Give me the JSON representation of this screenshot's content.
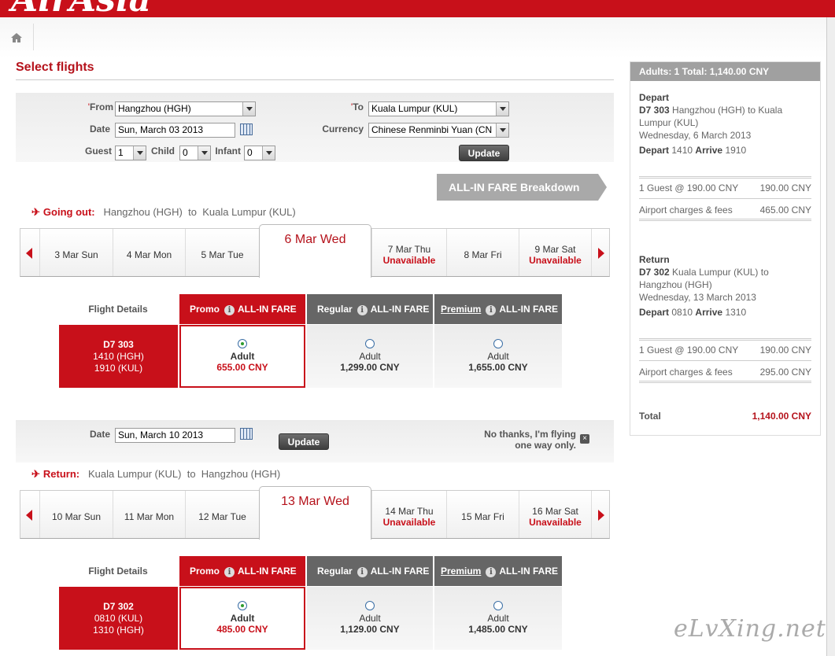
{
  "brand": {
    "logo": "AirAsia",
    "red": "#c8101a"
  },
  "nav": {
    "home_icon": "home-icon"
  },
  "page": {
    "title": "Select flights"
  },
  "search": {
    "from_label": "From",
    "from_value": "Hangzhou (HGH)",
    "to_label": "To",
    "to_value": "Kuala Lumpur (KUL)",
    "date_label": "Date",
    "date_value": "Sun, March 03 2013",
    "currency_label": "Currency",
    "currency_value": "Chinese Renminbi Yuan (CN",
    "guest_label": "Guest",
    "guest_value": "1",
    "child_label": "Child",
    "child_value": "0",
    "infant_label": "Infant",
    "infant_value": "0",
    "update_label": "Update"
  },
  "breakdown": {
    "label": "ALL-IN FARE Breakdown"
  },
  "outbound": {
    "label": "Going out:",
    "from": "Hangzhou (HGH)",
    "to_word": "to",
    "to": "Kuala Lumpur (KUL)",
    "dates": [
      {
        "label": "3 Mar Sun",
        "status": ""
      },
      {
        "label": "4 Mar Mon",
        "status": ""
      },
      {
        "label": "5 Mar Tue",
        "status": ""
      },
      {
        "label": "6 Mar Wed",
        "status": ""
      },
      {
        "label": "7 Mar Thu",
        "status": "Unavailable"
      },
      {
        "label": "8 Mar Fri",
        "status": ""
      },
      {
        "label": "9 Mar Sat",
        "status": "Unavailable"
      }
    ],
    "flight_details_label": "Flight Details",
    "fares": [
      {
        "name": "Promo",
        "tag": "ALL-IN FARE"
      },
      {
        "name": "Regular",
        "tag": "ALL-IN FARE"
      },
      {
        "name": "Premium",
        "tag": "ALL-IN FARE"
      }
    ],
    "flight": {
      "number": "D7  303",
      "depart": "1410  (HGH)",
      "arrive": "1910  (KUL)"
    },
    "prices": [
      {
        "pax": "Adult",
        "amount": "655.00 CNY",
        "selected": true
      },
      {
        "pax": "Adult",
        "amount": "1,299.00 CNY",
        "selected": false
      },
      {
        "pax": "Adult",
        "amount": "1,655.00 CNY",
        "selected": false
      }
    ]
  },
  "return_search": {
    "date_label": "Date",
    "date_value": "Sun, March 10 2013",
    "update_label": "Update",
    "no_thanks": "No thanks, I'm flying",
    "no_thanks_2": "one way only."
  },
  "inbound": {
    "label": "Return:",
    "from": "Kuala Lumpur (KUL)",
    "to_word": "to",
    "to": "Hangzhou (HGH)",
    "dates": [
      {
        "label": "10 Mar Sun",
        "status": ""
      },
      {
        "label": "11 Mar Mon",
        "status": ""
      },
      {
        "label": "12 Mar Tue",
        "status": ""
      },
      {
        "label": "13 Mar Wed",
        "status": ""
      },
      {
        "label": "14 Mar Thu",
        "status": "Unavailable"
      },
      {
        "label": "15 Mar Fri",
        "status": ""
      },
      {
        "label": "16 Mar Sat",
        "status": "Unavailable"
      }
    ],
    "flight_details_label": "Flight Details",
    "fares": [
      {
        "name": "Promo",
        "tag": "ALL-IN FARE"
      },
      {
        "name": "Regular",
        "tag": "ALL-IN FARE"
      },
      {
        "name": "Premium",
        "tag": "ALL-IN FARE"
      }
    ],
    "flight": {
      "number": "D7  302",
      "depart": "0810  (KUL)",
      "arrive": "1310  (HGH)"
    },
    "prices": [
      {
        "pax": "Adult",
        "amount": "485.00 CNY",
        "selected": true
      },
      {
        "pax": "Adult",
        "amount": "1,129.00 CNY",
        "selected": false
      },
      {
        "pax": "Adult",
        "amount": "1,485.00 CNY",
        "selected": false
      }
    ]
  },
  "summary": {
    "header": "Adults: 1  Total: 1,140.00 CNY",
    "depart": {
      "title": "Depart",
      "flight_no": "D7 303",
      "route": "Hangzhou (HGH) to Kuala Lumpur (KUL)",
      "date": "Wednesday, 6 March 2013",
      "depart_word": "Depart",
      "depart_time": "1410",
      "arrive_word": "Arrive",
      "arrive_time": "1910",
      "guest_line": "1 Guest @ 190.00 CNY",
      "guest_amount": "190.00 CNY",
      "fees_line": "Airport charges & fees",
      "fees_amount": "465.00 CNY"
    },
    "return": {
      "title": "Return",
      "flight_no": "D7 302",
      "route": "Kuala Lumpur (KUL) to Hangzhou (HGH)",
      "date": "Wednesday, 13 March 2013",
      "depart_word": "Depart",
      "depart_time": "0810",
      "arrive_word": "Arrive",
      "arrive_time": "1310",
      "guest_line": "1 Guest @ 190.00 CNY",
      "guest_amount": "190.00 CNY",
      "fees_line": "Airport charges & fees",
      "fees_amount": "295.00 CNY"
    },
    "total_label": "Total",
    "total_amount": "1,140.00 CNY"
  },
  "watermark": "eLvXing.net"
}
